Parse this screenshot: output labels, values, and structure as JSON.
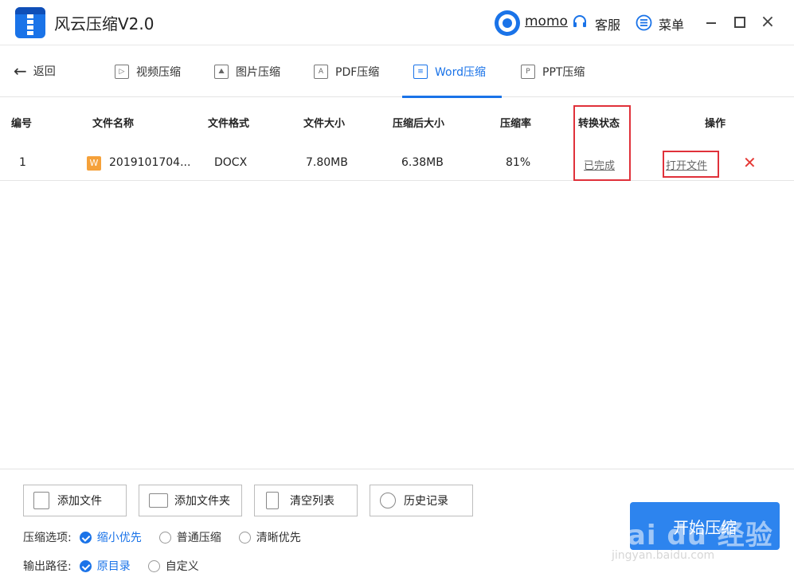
{
  "app": {
    "title": "风云压缩V2.0"
  },
  "header": {
    "username": "momo",
    "service_label": "客服",
    "menu_label": "菜单",
    "close_glyph": "×"
  },
  "nav": {
    "back_label": "返回",
    "tabs": [
      {
        "label": "视频压缩",
        "icon": "video-icon",
        "glyph": "▷"
      },
      {
        "label": "图片压缩",
        "icon": "image-icon",
        "glyph": "⛰"
      },
      {
        "label": "PDF压缩",
        "icon": "pdf-icon",
        "glyph": "A"
      },
      {
        "label": "Word压缩",
        "icon": "word-icon",
        "glyph": "≡",
        "active": true
      },
      {
        "label": "PPT压缩",
        "icon": "ppt-icon",
        "glyph": "P"
      }
    ]
  },
  "table": {
    "headers": [
      "编号",
      "文件名称",
      "文件格式",
      "文件大小",
      "压缩后大小",
      "压缩率",
      "转换状态",
      "操作"
    ],
    "rows": [
      {
        "index": "1",
        "badge": "W",
        "name": "2019101704...",
        "format": "DOCX",
        "size": "7.80MB",
        "compressed_size": "6.38MB",
        "ratio": "81%",
        "status": "已完成",
        "action": "打开文件",
        "delete_glyph": "✕"
      }
    ]
  },
  "toolbar": {
    "buttons": [
      "添加文件",
      "添加文件夹",
      "清空列表",
      "历史记录"
    ]
  },
  "options": {
    "compress_label": "压缩选项:",
    "compress_choices": [
      "缩小优先",
      "普通压缩",
      "清晰优先"
    ],
    "compress_selected": "缩小优先",
    "output_label": "输出路径:",
    "output_choices": [
      "原目录",
      "自定义"
    ],
    "output_selected": "原目录"
  },
  "start_button": {
    "label": "开始压缩"
  },
  "watermark": {
    "text": "Bai du 经验",
    "sub": "jingyan.baidu.com"
  },
  "colors": {
    "accent": "#1a73e8",
    "highlight": "#e0313a",
    "badge": "#f5a13a",
    "delete": "#e53935"
  }
}
